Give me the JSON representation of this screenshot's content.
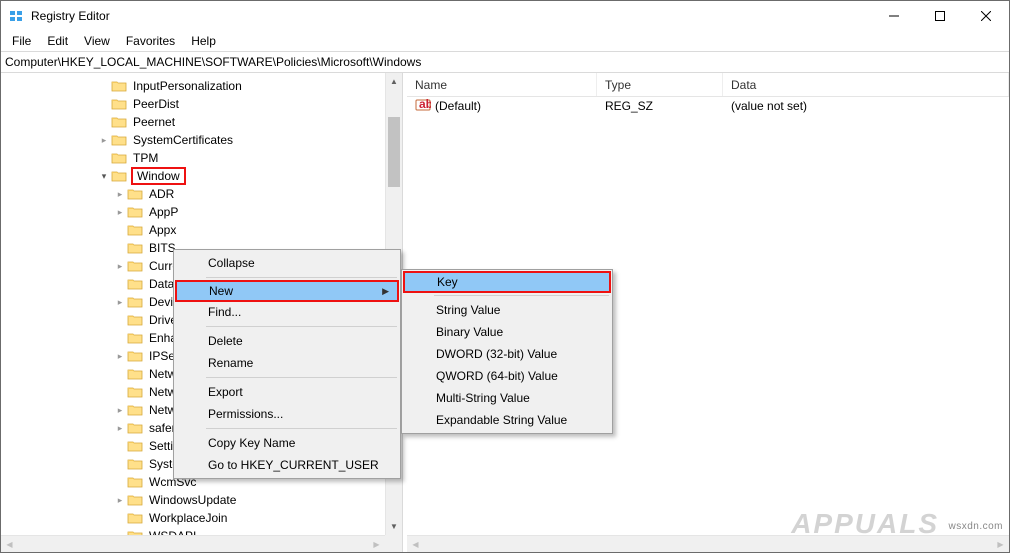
{
  "window": {
    "title": "Registry Editor"
  },
  "menu": {
    "file": "File",
    "edit": "Edit",
    "view": "View",
    "favorites": "Favorites",
    "help": "Help"
  },
  "address": {
    "path": "Computer\\HKEY_LOCAL_MACHINE\\SOFTWARE\\Policies\\Microsoft\\Windows"
  },
  "tree": {
    "items": [
      {
        "indent": 96,
        "arrow": "",
        "label": "InputPersonalization"
      },
      {
        "indent": 96,
        "arrow": "",
        "label": "PeerDist"
      },
      {
        "indent": 96,
        "arrow": "",
        "label": "Peernet"
      },
      {
        "indent": 96,
        "arrow": "col",
        "label": "SystemCertificates"
      },
      {
        "indent": 96,
        "arrow": "",
        "label": "TPM"
      },
      {
        "indent": 96,
        "arrow": "exp",
        "label": "Window",
        "selected": true
      },
      {
        "indent": 112,
        "arrow": "col",
        "label": "ADR"
      },
      {
        "indent": 112,
        "arrow": "col",
        "label": "AppP"
      },
      {
        "indent": 112,
        "arrow": "",
        "label": "Appx"
      },
      {
        "indent": 112,
        "arrow": "",
        "label": "BITS"
      },
      {
        "indent": 112,
        "arrow": "col",
        "label": "Curre"
      },
      {
        "indent": 112,
        "arrow": "",
        "label": "DataC"
      },
      {
        "indent": 112,
        "arrow": "col",
        "label": "Devic"
      },
      {
        "indent": 112,
        "arrow": "",
        "label": "Drive"
      },
      {
        "indent": 112,
        "arrow": "",
        "label": "Enha"
      },
      {
        "indent": 112,
        "arrow": "col",
        "label": "IPSec"
      },
      {
        "indent": 112,
        "arrow": "",
        "label": "Netw"
      },
      {
        "indent": 112,
        "arrow": "",
        "label": "Netw"
      },
      {
        "indent": 112,
        "arrow": "col",
        "label": "NetworkProvider"
      },
      {
        "indent": 112,
        "arrow": "col",
        "label": "safer"
      },
      {
        "indent": 112,
        "arrow": "",
        "label": "SettingSync"
      },
      {
        "indent": 112,
        "arrow": "",
        "label": "System"
      },
      {
        "indent": 112,
        "arrow": "",
        "label": "WcmSvc"
      },
      {
        "indent": 112,
        "arrow": "col",
        "label": "WindowsUpdate"
      },
      {
        "indent": 112,
        "arrow": "",
        "label": "WorkplaceJoin"
      },
      {
        "indent": 112,
        "arrow": "",
        "label": "WSDAPI"
      }
    ]
  },
  "list": {
    "columns": {
      "name": "Name",
      "type": "Type",
      "data": "Data"
    },
    "rows": [
      {
        "name": "(Default)",
        "type": "REG_SZ",
        "data": "(value not set)"
      }
    ]
  },
  "ctx1": {
    "collapse": "Collapse",
    "new": "New",
    "find": "Find...",
    "delete": "Delete",
    "rename": "Rename",
    "export": "Export",
    "permissions": "Permissions...",
    "copykey": "Copy Key Name",
    "gohkcu": "Go to HKEY_CURRENT_USER"
  },
  "ctx2": {
    "key": "Key",
    "string": "String Value",
    "binary": "Binary Value",
    "dword": "DWORD (32-bit) Value",
    "qword": "QWORD (64-bit) Value",
    "multi": "Multi-String Value",
    "expand": "Expandable String Value"
  },
  "watermark": "wsxdn.com",
  "logo": "APPUALS"
}
